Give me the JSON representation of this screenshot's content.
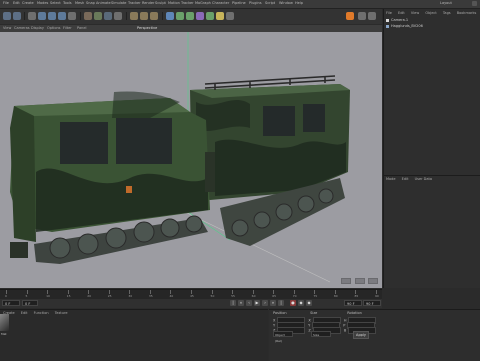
{
  "menu": {
    "items": [
      "File",
      "Edit",
      "Create",
      "Modes",
      "Select",
      "Tools",
      "Mesh",
      "Snap",
      "Animate",
      "Simulate",
      "Tracker",
      "Render",
      "Sculpt",
      "Motion Tracker",
      "MoGraph",
      "Character",
      "Pipeline",
      "Plugins",
      "Script",
      "Window",
      "Help"
    ],
    "layout_label": "Layout"
  },
  "viewport": {
    "header_items": [
      "View",
      "Cameras",
      "Display",
      "Options",
      "Filter",
      "Panel"
    ],
    "label": "Perspective"
  },
  "right_panel": {
    "tabs": [
      "File",
      "Edit",
      "View",
      "Object",
      "Tags",
      "Bookmarks"
    ],
    "objects": [
      {
        "name": "Camera.1",
        "color": "#d8d8d8"
      },
      {
        "name": "Hagglunds_BV206",
        "color": "#8aa6c8"
      }
    ],
    "attr_tabs": [
      "Mode",
      "Edit",
      "User Data"
    ]
  },
  "timeline": {
    "frames": [
      "0",
      "5",
      "10",
      "15",
      "20",
      "25",
      "30",
      "35",
      "40",
      "45",
      "50",
      "55",
      "60",
      "65",
      "70",
      "75",
      "80",
      "85",
      "90"
    ]
  },
  "transport": {
    "start_frame": "0 F",
    "current_frame": "0 F",
    "end_frame": "90 F",
    "max_frame": "90 F"
  },
  "material_panel": {
    "tabs": [
      "Create",
      "Edit",
      "Function",
      "Texture"
    ],
    "material_name": "Mat"
  },
  "coordinates": {
    "headers": [
      "Position",
      "Size",
      "Rotation"
    ],
    "rows": [
      {
        "axis": "X",
        "pos": "0 cm",
        "size": "0 cm",
        "rot_label": "H",
        "rot": "0 °"
      },
      {
        "axis": "Y",
        "pos": "0 cm",
        "size": "0 cm",
        "rot_label": "P",
        "rot": "0 °"
      },
      {
        "axis": "Z",
        "pos": "0 cm",
        "size": "0 cm",
        "rot_label": "B",
        "rot": "0 °"
      }
    ],
    "mode_select": "Object (Rel)",
    "size_select": "Size",
    "apply_label": "Apply"
  },
  "colors": {
    "viewport_bg": "#9c9ca2",
    "camo_dark": "#1e2a1e",
    "camo_green": "#3f5a38",
    "accent_orange": "#e07a2a"
  },
  "icons": [
    "undo-icon",
    "redo-icon",
    "select-icon",
    "move-icon",
    "scale-icon",
    "rotate-icon",
    "render-icon",
    "cube-icon",
    "light-icon",
    "camera-icon",
    "play-icon",
    "stop-icon",
    "record-icon",
    "key-icon"
  ]
}
